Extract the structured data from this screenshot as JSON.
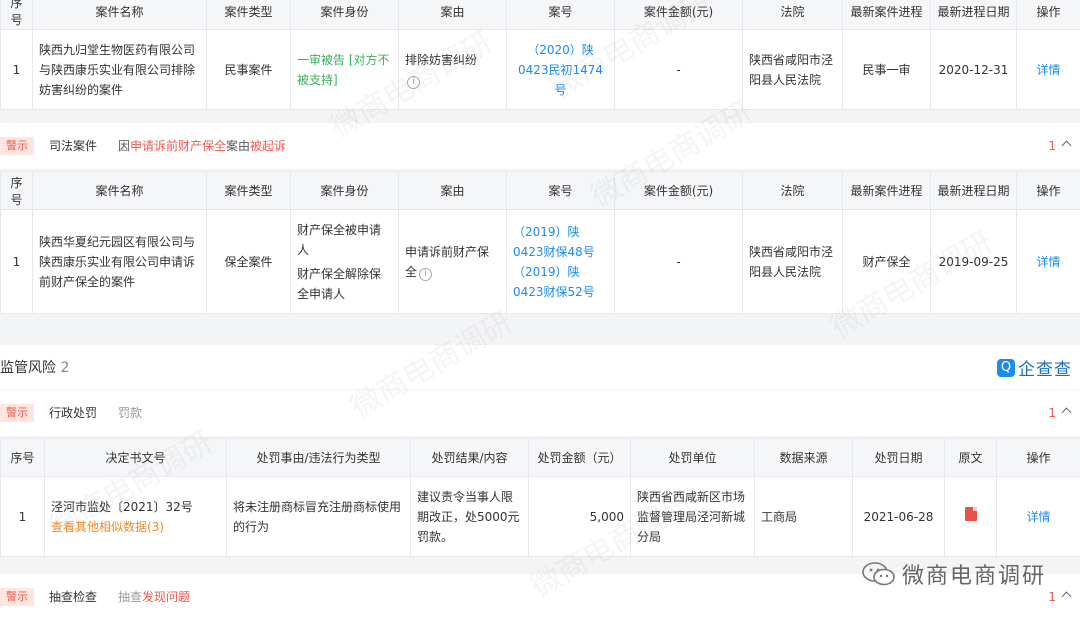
{
  "top_table": {
    "headers": [
      "序号",
      "案件名称",
      "案件类型",
      "案件身份",
      "案由",
      "案号",
      "案件金额(元)",
      "法院",
      "最新案件进程",
      "最新进程日期",
      "操作"
    ],
    "row": {
      "index": "1",
      "name": "陕西九归堂生物医药有限公司与陕西康乐实业有限公司排除妨害纠纷的案件",
      "type": "民事案件",
      "role_main": "一审被告",
      "role_note": "[对方不被支持]",
      "cause": "排除妨害纠纷",
      "case_no": "（2020）陕0423民初1474号",
      "amount": "-",
      "court": "陕西省咸阳市泾阳县人民法院",
      "progress": "民事一审",
      "date": "2020-12-31",
      "action": "详情"
    }
  },
  "judicial_section": {
    "badge": "警示",
    "title": "司法案件",
    "desc_prefix": "因",
    "desc_red1": "申请诉前财产保全",
    "desc_mid": "案由",
    "desc_red2": "被起诉",
    "count": "1"
  },
  "judicial_table": {
    "headers": [
      "序号",
      "案件名称",
      "案件类型",
      "案件身份",
      "案由",
      "案号",
      "案件金额(元)",
      "法院",
      "最新案件进程",
      "最新进程日期",
      "操作"
    ],
    "row": {
      "index": "1",
      "name": "陕西华夏纪元园区有限公司与陕西康乐实业有限公司申请诉前财产保全的案件",
      "type": "保全案件",
      "role1": "财产保全被申请人",
      "role2": "财产保全解除保全申请人",
      "cause": "申请诉前财产保全",
      "case_no1": "（2019）陕0423财保48号",
      "case_no2": "（2019）陕0423财保52号",
      "amount": "-",
      "court": "陕西省咸阳市泾阳县人民法院",
      "progress": "财产保全",
      "date": "2019-09-25",
      "action": "详情"
    }
  },
  "regulatory": {
    "title": "监管风险",
    "count": "2",
    "brand": "企查查"
  },
  "admin_section": {
    "badge": "警示",
    "title": "行政处罚",
    "desc": "罚款",
    "count": "1"
  },
  "penalty_table": {
    "headers": [
      "序号",
      "决定书文号",
      "处罚事由/违法行为类型",
      "处罚结果/内容",
      "处罚金额（元）",
      "处罚单位",
      "数据来源",
      "处罚日期",
      "原文",
      "操作"
    ],
    "row": {
      "index": "1",
      "doc_no": "泾河市监处〔2021〕32号",
      "similar": "查看其他相似数据(3)",
      "reason": "将未注册商标冒充注册商标使用的行为",
      "result": "建议责令当事人限期改正，处5000元罚款。",
      "amount": "5,000",
      "unit": "陕西省西咸新区市场监督管理局泾河新城分局",
      "source": "工商局",
      "date": "2021-06-28",
      "action": "详情"
    }
  },
  "inspection_section": {
    "badge": "警示",
    "title": "抽查检查",
    "desc_prefix": "抽查",
    "desc_red": "发现问题",
    "count": "1"
  },
  "watermark": {
    "text": "微商电商调研",
    "wechat_label": "微商电商调研"
  },
  "colors": {
    "accent_blue": "#1a8cf0",
    "warn_red": "#f05a4f",
    "green": "#3bb05e",
    "orange": "#f08a24"
  }
}
